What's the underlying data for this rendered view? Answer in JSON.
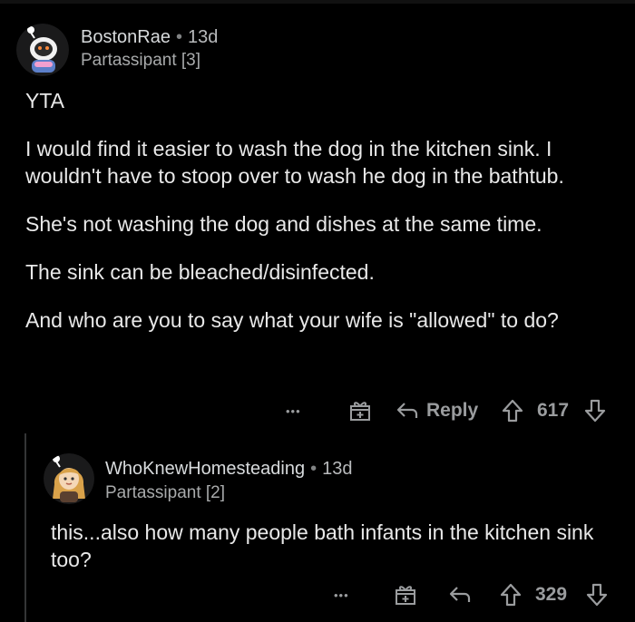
{
  "comments": [
    {
      "username": "BostonRae",
      "separator": "•",
      "age": "13d",
      "flair": "Partassipant [3]",
      "paragraphs": [
        "YTA",
        "I would find it easier to wash the dog in the kitchen sink. I wouldn't have to stoop over to wash he dog in the bathtub.",
        "She's not washing the dog and dishes at the same time.",
        "The sink can be bleached/disinfected.",
        "And who are you to say what your wife is \"allowed\" to do?"
      ],
      "more_label": "•••",
      "reply_label": "Reply",
      "score": "617"
    },
    {
      "username": "WhoKnewHomesteading",
      "separator": "•",
      "age": "13d",
      "flair": "Partassipant [2]",
      "paragraphs": [
        "this...also how many people bath infants in the kitchen sink too?"
      ],
      "more_label": "•••",
      "score": "329"
    }
  ],
  "colors": {
    "background": "#000000",
    "text": "#e8e8e8",
    "muted": "#9a9c9e",
    "thread_line": "#343536"
  },
  "icons": [
    "award-gift-icon",
    "reply-arrow-icon",
    "upvote-icon",
    "downvote-icon",
    "more-options-icon"
  ]
}
